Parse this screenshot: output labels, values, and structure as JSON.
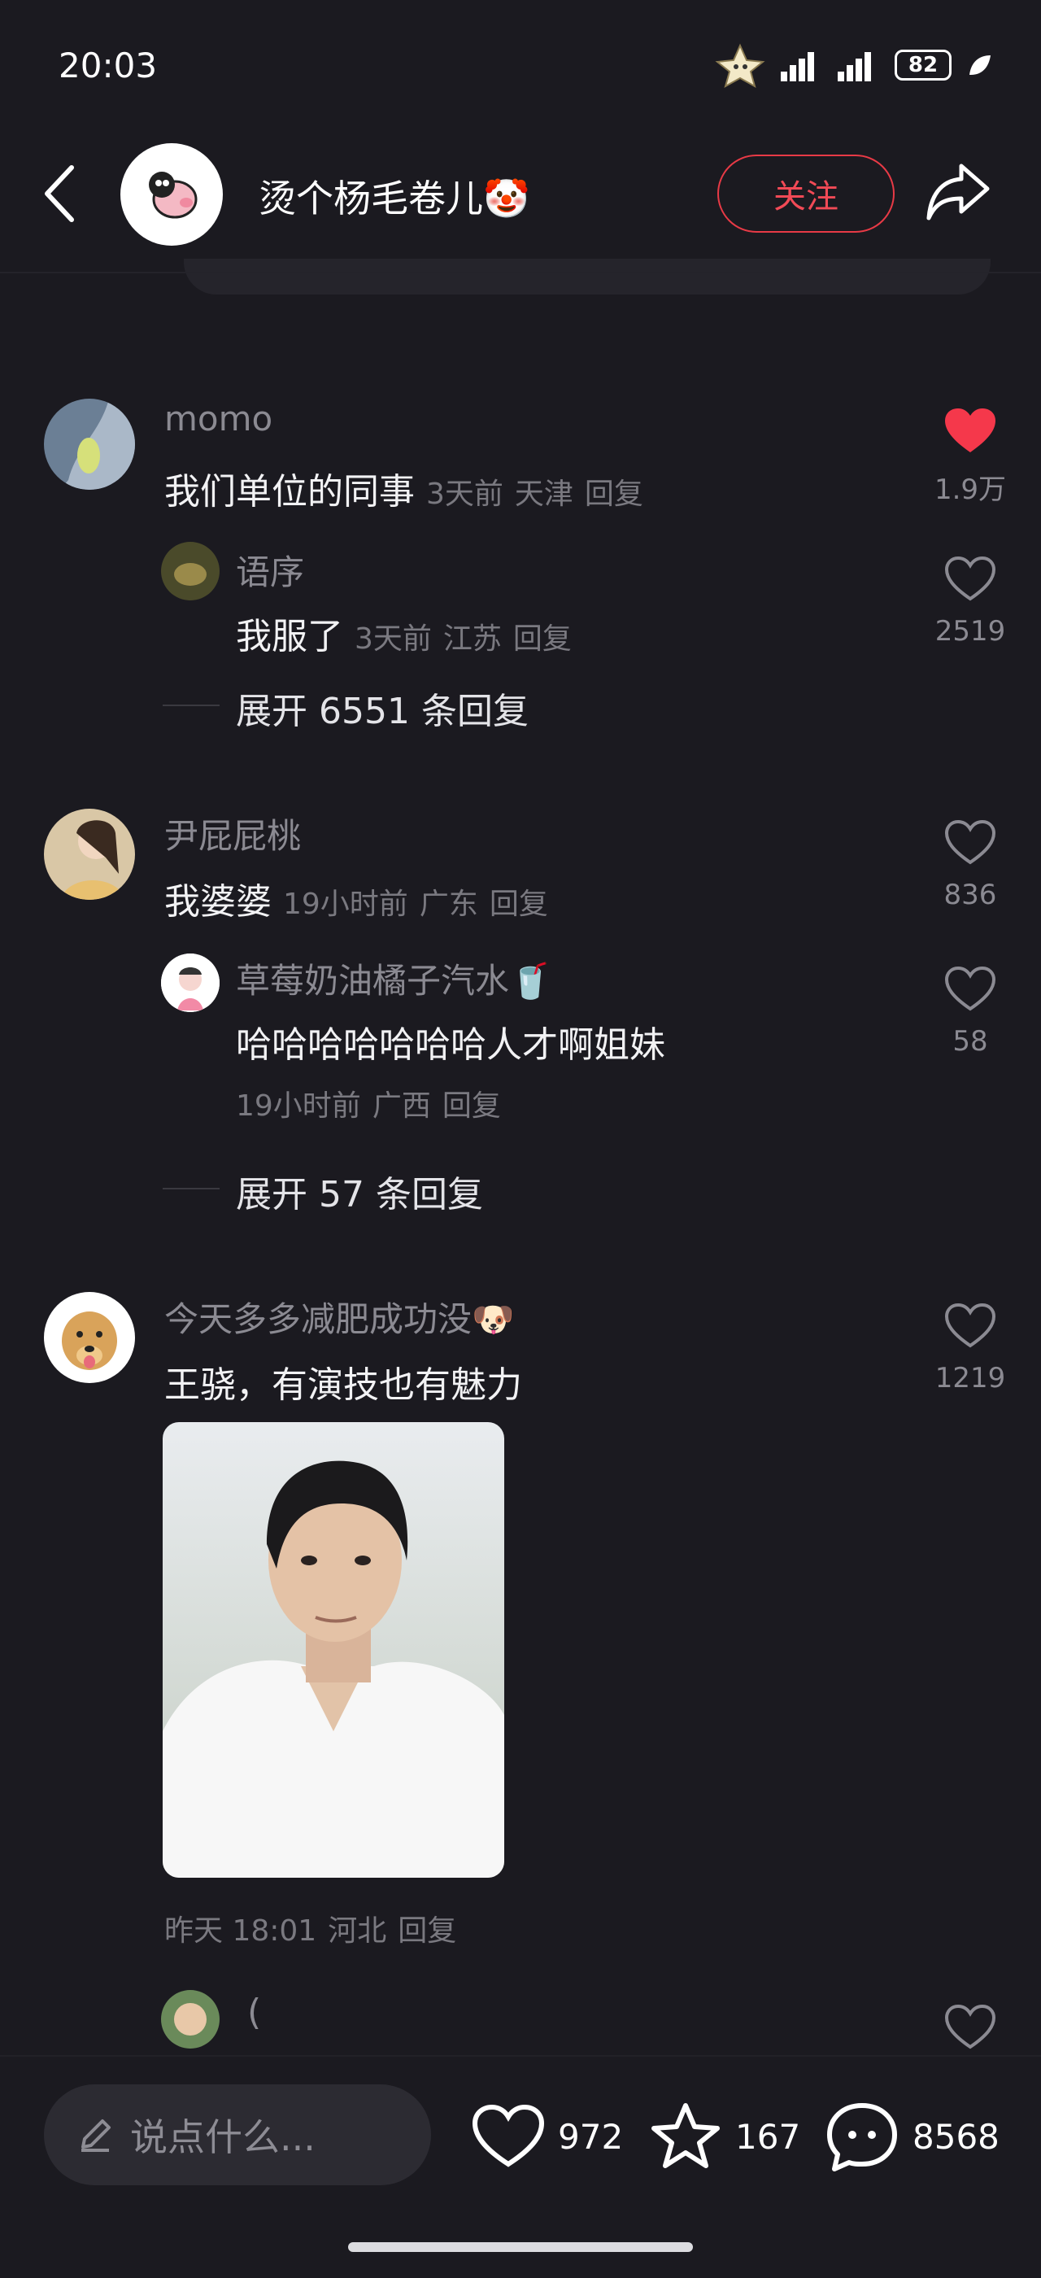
{
  "status_bar": {
    "time": "20:03",
    "battery": "82"
  },
  "header": {
    "title": "烫个杨毛卷儿🤡",
    "follow_label": "关注"
  },
  "comments": [
    {
      "username": "momo",
      "text": "我们单位的同事",
      "time": "3天前",
      "location": "天津",
      "reply_label": "回复",
      "likes": "1.9万",
      "liked": true,
      "sub_reply": {
        "username": "语序",
        "text": "我服了",
        "time": "3天前",
        "location": "江苏",
        "reply_label": "回复",
        "likes": "2519"
      },
      "expand_label": "展开 6551 条回复"
    },
    {
      "username": "尹屁屁桃",
      "text": "我婆婆",
      "time": "19小时前",
      "location": "广东",
      "reply_label": "回复",
      "likes": "836",
      "liked": false,
      "sub_reply": {
        "username": "草莓奶油橘子汽水🥤",
        "text": "哈哈哈哈哈哈哈人才啊姐妹",
        "time": "19小时前",
        "location": "广西",
        "reply_label": "回复",
        "likes": "58"
      },
      "expand_label": "展开 57 条回复"
    },
    {
      "username": "今天多多减肥成功没🐶",
      "text": "王骁，有演技也有魅力",
      "time": "昨天 18:01",
      "location": "河北",
      "reply_label": "回复",
      "likes": "1219",
      "liked": false,
      "sub_reply_preview": {
        "text": "("
      }
    }
  ],
  "bottom_bar": {
    "input_placeholder": "说点什么...",
    "likes": "972",
    "favorites": "167",
    "comments": "8568"
  },
  "colors": {
    "background": "#1b1a20",
    "accent_red": "#f24a56",
    "muted": "#8b8a92"
  }
}
